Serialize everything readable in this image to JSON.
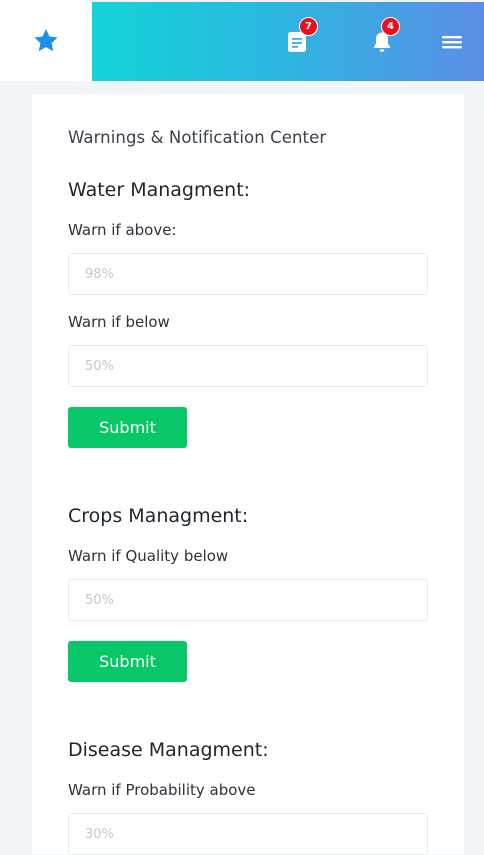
{
  "header": {
    "logo_icon": "star-icon",
    "messages_badge": "7",
    "notifications_badge": "4",
    "menu_icon": "hamburger-menu-icon",
    "accent_color": "#1f8fe8"
  },
  "page": {
    "title": "Warnings & Notification Center"
  },
  "water": {
    "title": "Water Managment:",
    "above_label": "Warn if above:",
    "above_placeholder": "98%",
    "below_label": "Warn if below",
    "below_placeholder": "50%",
    "submit_label": "Submit"
  },
  "crops": {
    "title": "Crops Managment:",
    "quality_label": "Warn if Quality below",
    "quality_placeholder": "50%",
    "submit_label": "Submit"
  },
  "disease": {
    "title": "Disease Managment:",
    "probability_label": "Warn if Probability above",
    "probability_placeholder": "30%"
  },
  "colors": {
    "submit": "#07c768",
    "badge": "#e8101e",
    "gradient_start": "#14d4d8",
    "gradient_end": "#5b8ee6"
  }
}
